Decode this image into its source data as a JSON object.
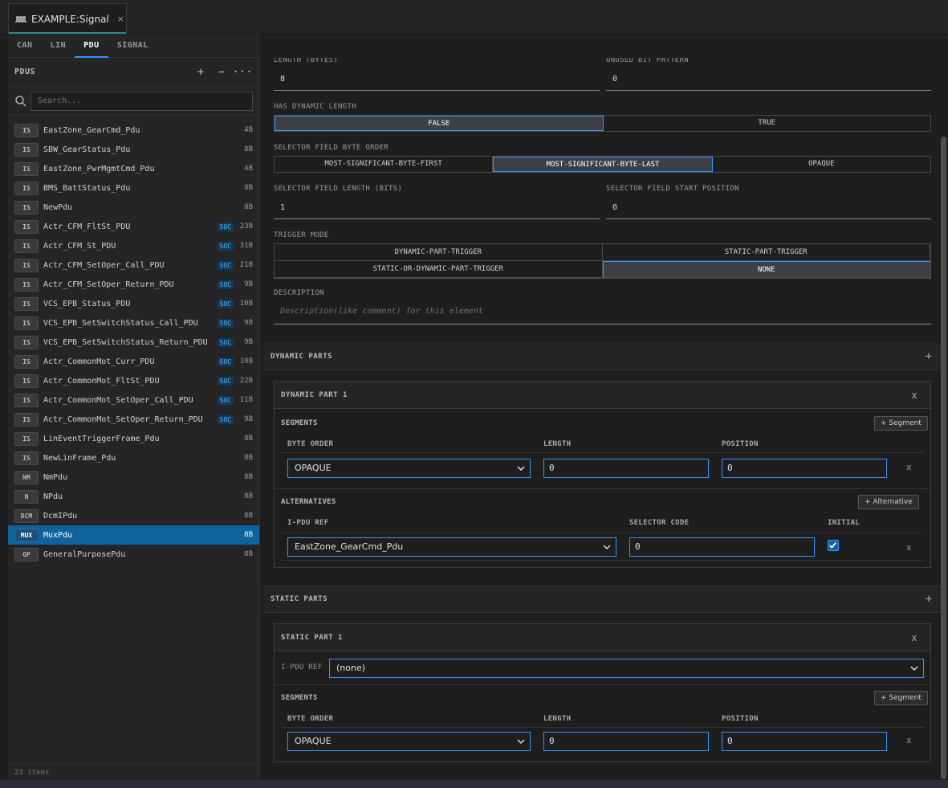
{
  "tab": {
    "title": "EXAMPLE:Signal",
    "close": "×",
    "icon": "signal-wave-icon"
  },
  "subtabs": [
    "CAN",
    "LIN",
    "PDU",
    "SIGNAL"
  ],
  "active_subtab": "PDU",
  "left": {
    "title": "PDUS",
    "add": "+",
    "remove": "−",
    "more": "···",
    "search_placeholder": "Search...",
    "footer": "23 items",
    "items": [
      {
        "badge": "IS",
        "name": "EastZone_GearCmd_Pdu",
        "soc": "",
        "size": "4B"
      },
      {
        "badge": "IS",
        "name": "SBW_GearStatus_Pdu",
        "soc": "",
        "size": "8B"
      },
      {
        "badge": "IS",
        "name": "EastZone_PwrMgmtCmd_Pdu",
        "soc": "",
        "size": "4B"
      },
      {
        "badge": "IS",
        "name": "BMS_BattStatus_Pdu",
        "soc": "",
        "size": "8B"
      },
      {
        "badge": "IS",
        "name": "NewPdu",
        "soc": "",
        "size": "8B"
      },
      {
        "badge": "IS",
        "name": "Actr_CFM_FltSt_PDU",
        "soc": "SOC",
        "size": "23B"
      },
      {
        "badge": "IS",
        "name": "Actr_CFM_St_PDU",
        "soc": "SOC",
        "size": "31B"
      },
      {
        "badge": "IS",
        "name": "Actr_CFM_SetOper_Call_PDU",
        "soc": "SOC",
        "size": "21B"
      },
      {
        "badge": "IS",
        "name": "Actr_CFM_SetOper_Return_PDU",
        "soc": "SOC",
        "size": "9B"
      },
      {
        "badge": "IS",
        "name": "VCS_EPB_Status_PDU",
        "soc": "SOC",
        "size": "10B"
      },
      {
        "badge": "IS",
        "name": "VCS_EPB_SetSwitchStatus_Call_PDU",
        "soc": "SOC",
        "size": "9B"
      },
      {
        "badge": "IS",
        "name": "VCS_EPB_SetSwitchStatus_Return_PDU",
        "soc": "SOC",
        "size": "9B"
      },
      {
        "badge": "IS",
        "name": "Actr_CommonMot_Curr_PDU",
        "soc": "SOC",
        "size": "10B"
      },
      {
        "badge": "IS",
        "name": "Actr_CommonMot_FltSt_PDU",
        "soc": "SOC",
        "size": "22B"
      },
      {
        "badge": "IS",
        "name": "Actr_CommonMot_SetOper_Call_PDU",
        "soc": "SOC",
        "size": "11B"
      },
      {
        "badge": "IS",
        "name": "Actr_CommonMot_SetOper_Return_PDU",
        "soc": "SOC",
        "size": "9B"
      },
      {
        "badge": "IS",
        "name": "LinEventTriggerFrame_Pdu",
        "soc": "",
        "size": "8B"
      },
      {
        "badge": "IS",
        "name": "NewLinFrame_Pdu",
        "soc": "",
        "size": "8B"
      },
      {
        "badge": "NM",
        "name": "NmPdu",
        "soc": "",
        "size": "8B"
      },
      {
        "badge": "N",
        "name": "NPdu",
        "soc": "",
        "size": "8B"
      },
      {
        "badge": "DCM",
        "name": "DcmIPdu",
        "soc": "",
        "size": "8B"
      },
      {
        "badge": "MUX",
        "name": "MuxPdu",
        "soc": "",
        "size": "8B",
        "selected": true
      },
      {
        "badge": "GP",
        "name": "GeneralPurposePdu",
        "soc": "",
        "size": "8B"
      }
    ]
  },
  "form": {
    "length_label": "LENGTH (BYTES)",
    "length_value": "8",
    "unused_label": "UNUSED BIT PATTERN",
    "unused_value": "0",
    "dynlen_label": "HAS DYNAMIC LENGTH",
    "dynlen_options": [
      "FALSE",
      "TRUE"
    ],
    "dynlen_selected": "FALSE",
    "byteorder_label": "SELECTOR FIELD BYTE ORDER",
    "byteorder_options": [
      "MOST-SIGNIFICANT-BYTE-FIRST",
      "MOST-SIGNIFICANT-BYTE-LAST",
      "OPAQUE"
    ],
    "byteorder_selected": "MOST-SIGNIFICANT-BYTE-LAST",
    "sel_len_label": "SELECTOR FIELD LENGTH (BITS)",
    "sel_len_value": "1",
    "sel_start_label": "SELECTOR FIELD START POSITION",
    "sel_start_value": "0",
    "trigger_label": "TRIGGER MODE",
    "trigger_options": [
      "DYNAMIC-PART-TRIGGER",
      "STATIC-PART-TRIGGER",
      "STATIC-OR-DYNAMIC-PART-TRIGGER",
      "NONE"
    ],
    "trigger_selected": "NONE",
    "desc_label": "DESCRIPTION",
    "desc_placeholder": "Description(like comment) for this element"
  },
  "dynamic": {
    "section_title": "DYNAMIC PARTS",
    "add": "+",
    "part_title": "DYNAMIC PART 1",
    "close": "x",
    "segments_label": "SEGMENTS",
    "add_segment": "+ Segment",
    "col_byte_order": "BYTE ORDER",
    "col_length": "LENGTH",
    "col_position": "POSITION",
    "seg_byte_order": "OPAQUE",
    "seg_length": "0",
    "seg_position": "0",
    "row_remove": "x",
    "alternatives_label": "ALTERNATIVES",
    "add_alternative": "+ Alternative",
    "col_ipdu": "I-PDU REF",
    "col_selector": "SELECTOR CODE",
    "col_initial": "INITIAL",
    "alt_ipdu": "EastZone_GearCmd_Pdu",
    "alt_selector": "0",
    "alt_initial": true,
    "alt_remove": "x"
  },
  "static": {
    "section_title": "STATIC PARTS",
    "add": "+",
    "part_title": "STATIC PART 1",
    "close": "x",
    "ipdu_label": "I-PDU REF",
    "ipdu_value": "(none)",
    "segments_label": "SEGMENTS",
    "add_segment": "+ Segment",
    "col_byte_order": "BYTE ORDER",
    "col_length": "LENGTH",
    "col_position": "POSITION",
    "seg_byte_order": "OPAQUE",
    "seg_length": "0",
    "seg_position": "0",
    "row_remove": "x"
  },
  "colors": {
    "accent": "#3794ff",
    "selection": "#0e639c",
    "tab_accent": "#1e8f8f"
  }
}
